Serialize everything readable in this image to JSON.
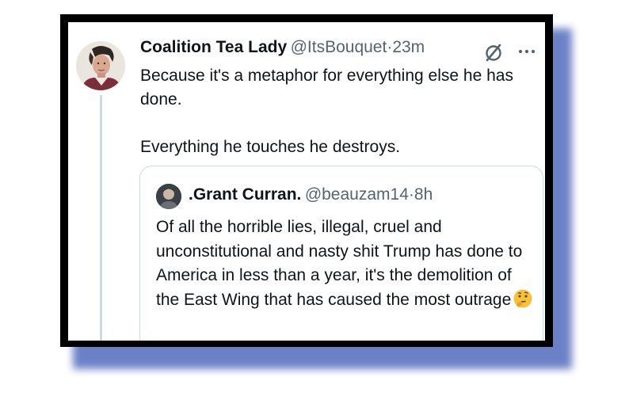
{
  "tweet": {
    "author_name": "Coalition Tea Lady",
    "author_handle": "@ItsBouquet",
    "separator": "·",
    "time": "23m",
    "text_line1": "Because it's a metaphor for everything else he has done.",
    "text_line2": "Everything he touches he destroys."
  },
  "quote": {
    "author_name": ".Grant Curran.",
    "author_handle": "@beauzam14",
    "separator": "·",
    "time": "8h",
    "text": "Of all the horrible lies, illegal, cruel and unconstitutional and nasty shit Trump has done to America in less than a year, it's the demolition of the East Wing that has caused the most outrage",
    "emoji_icon": "thinking-face-emoji"
  },
  "icons": {
    "grok": "grok-icon",
    "more": "more-options-icon"
  },
  "colors": {
    "frame": "#000000",
    "shadow": "#5d73c0",
    "text_primary": "#0f1419",
    "text_secondary": "#536471",
    "border": "#cfd9de"
  }
}
